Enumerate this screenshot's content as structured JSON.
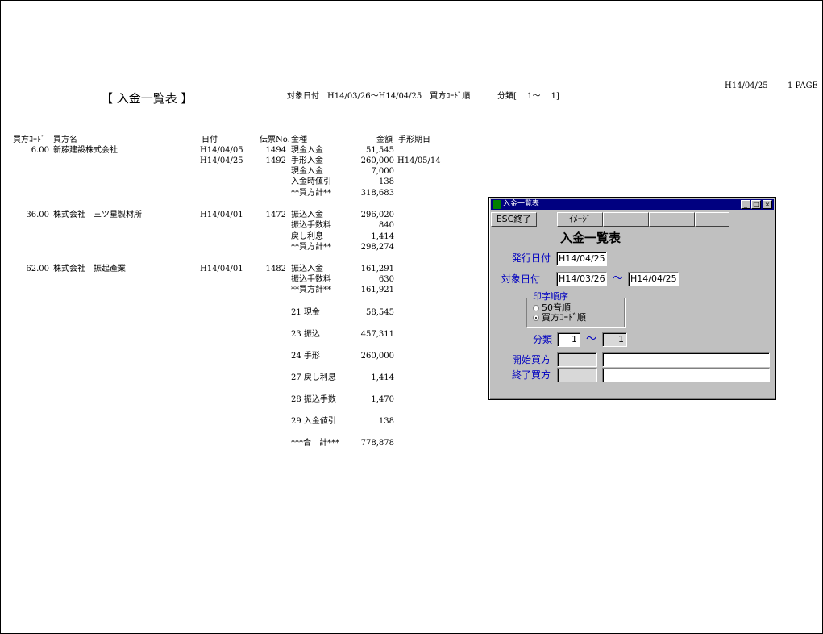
{
  "report": {
    "date": "H14/04/25",
    "page": "1 PAGE",
    "title": "【 入金一覧表 】",
    "target_date": "対象日付　H14/03/26～H14/04/25　買方ｺｰﾄﾞ順",
    "classification": "分類[　 1～　 1]",
    "headers": {
      "buyer_code": "買方ｺｰﾄﾞ",
      "buyer_name": "買方名",
      "date": "日付",
      "slip_no": "伝票No.",
      "kind": "金種",
      "amount": "金額",
      "due_date": "手形期日"
    },
    "groups": [
      {
        "code": "6.00",
        "name": "新藤建設株式会社",
        "rows": [
          {
            "date": "H14/04/05",
            "slip": "1494",
            "kind": "現金入金",
            "amount": "51,545",
            "due": ""
          },
          {
            "date": "H14/04/25",
            "slip": "1492",
            "kind": "手形入金",
            "amount": "260,000",
            "due": "H14/05/14"
          },
          {
            "date": "",
            "slip": "",
            "kind": "現金入金",
            "amount": "7,000",
            "due": ""
          },
          {
            "date": "",
            "slip": "",
            "kind": "入金時値引",
            "amount": "138",
            "due": ""
          },
          {
            "date": "",
            "slip": "",
            "kind": "**買方計**",
            "amount": "318,683",
            "due": ""
          }
        ]
      },
      {
        "code": "36.00",
        "name": "株式会社　三ツ星製材所",
        "rows": [
          {
            "date": "H14/04/01",
            "slip": "1472",
            "kind": "振込入金",
            "amount": "296,020",
            "due": ""
          },
          {
            "date": "",
            "slip": "",
            "kind": "振込手数料",
            "amount": "840",
            "due": ""
          },
          {
            "date": "",
            "slip": "",
            "kind": "戻し利息",
            "amount": "1,414",
            "due": ""
          },
          {
            "date": "",
            "slip": "",
            "kind": "**買方計**",
            "amount": "298,274",
            "due": ""
          }
        ]
      },
      {
        "code": "62.00",
        "name": "株式会社　振起產業",
        "rows": [
          {
            "date": "H14/04/01",
            "slip": "1482",
            "kind": "振込入金",
            "amount": "161,291",
            "due": ""
          },
          {
            "date": "",
            "slip": "",
            "kind": "振込手数料",
            "amount": "630",
            "due": ""
          },
          {
            "date": "",
            "slip": "",
            "kind": "**買方計**",
            "amount": "161,921",
            "due": ""
          }
        ]
      }
    ],
    "summary": [
      {
        "label": "21 現金",
        "amount": "58,545"
      },
      {
        "label": "23 振込",
        "amount": "457,311"
      },
      {
        "label": "24 手形",
        "amount": "260,000"
      },
      {
        "label": "27 戻し利息",
        "amount": "1,414"
      },
      {
        "label": "28 振込手数",
        "amount": "1,470"
      },
      {
        "label": "29 入金値引",
        "amount": "138"
      },
      {
        "label": "***合　計***",
        "amount": "778,878"
      }
    ]
  },
  "dialog": {
    "window_title": "入金一覧表",
    "esc_button": "ESC終了",
    "image_button": "ｲﾒｰｼﾞ",
    "heading": "入金一覧表",
    "issue_date_label": "発行日付",
    "issue_date": "H14/04/25",
    "target_date_label": "対象日付",
    "target_from": "H14/03/26",
    "target_tilde": "～",
    "target_to": "H14/04/25",
    "print_order_label": "印字順序",
    "order_option_1": "50音順",
    "order_option_2": "買方ｺｰﾄﾞ順",
    "class_label": "分類",
    "class_from": "1",
    "class_tilde": "～",
    "class_to": "1",
    "start_buyer_label": "開始買方",
    "end_buyer_label": "終了買方",
    "colors": {
      "caption": "#000080",
      "label": "#0000c0",
      "face": "#c0c0c0"
    }
  }
}
